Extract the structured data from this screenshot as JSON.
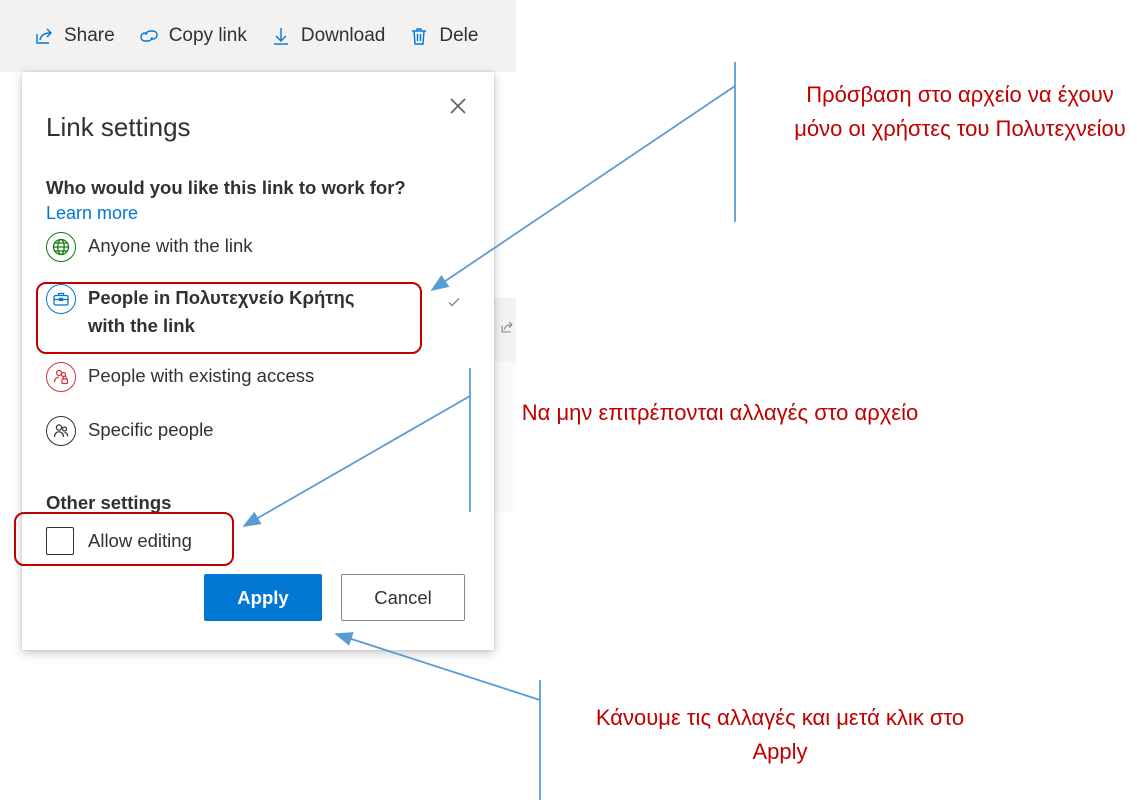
{
  "toolbar": {
    "share": "Share",
    "copy_link": "Copy link",
    "download": "Download",
    "delete": "Dele"
  },
  "dialog": {
    "title": "Link settings",
    "question": "Who would you like this link to work for?",
    "learn_more": "Learn more",
    "options": [
      {
        "label": "Anyone with the link",
        "icon": "globe-icon",
        "color": "#107c10"
      },
      {
        "label": "People in Πολυτεχνείο Κρήτης with the link",
        "icon": "briefcase-icon",
        "color": "#0078d4",
        "selected": true
      },
      {
        "label": "People with existing access",
        "icon": "people-lock-icon",
        "color": "#d13438"
      },
      {
        "label": "Specific people",
        "icon": "people-icon",
        "color": "#323130"
      }
    ],
    "other_settings": "Other settings",
    "allow_editing": "Allow editing",
    "allow_editing_checked": false,
    "apply_label": "Apply",
    "cancel_label": "Cancel"
  },
  "annotations": {
    "access_note": "Πρόσβαση στο αρχείο να έχουν μόνο οι χρήστες του Πολυτεχνείου",
    "editing_note": "Να μην επιτρέπονται αλλαγές στο αρχείο",
    "apply_note": "Κάνουμε τις αλλαγές και μετά κλικ στο Apply"
  },
  "colors": {
    "accent": "#0078d4",
    "annotation": "#c00000",
    "arrow": "#5b9bd5"
  }
}
